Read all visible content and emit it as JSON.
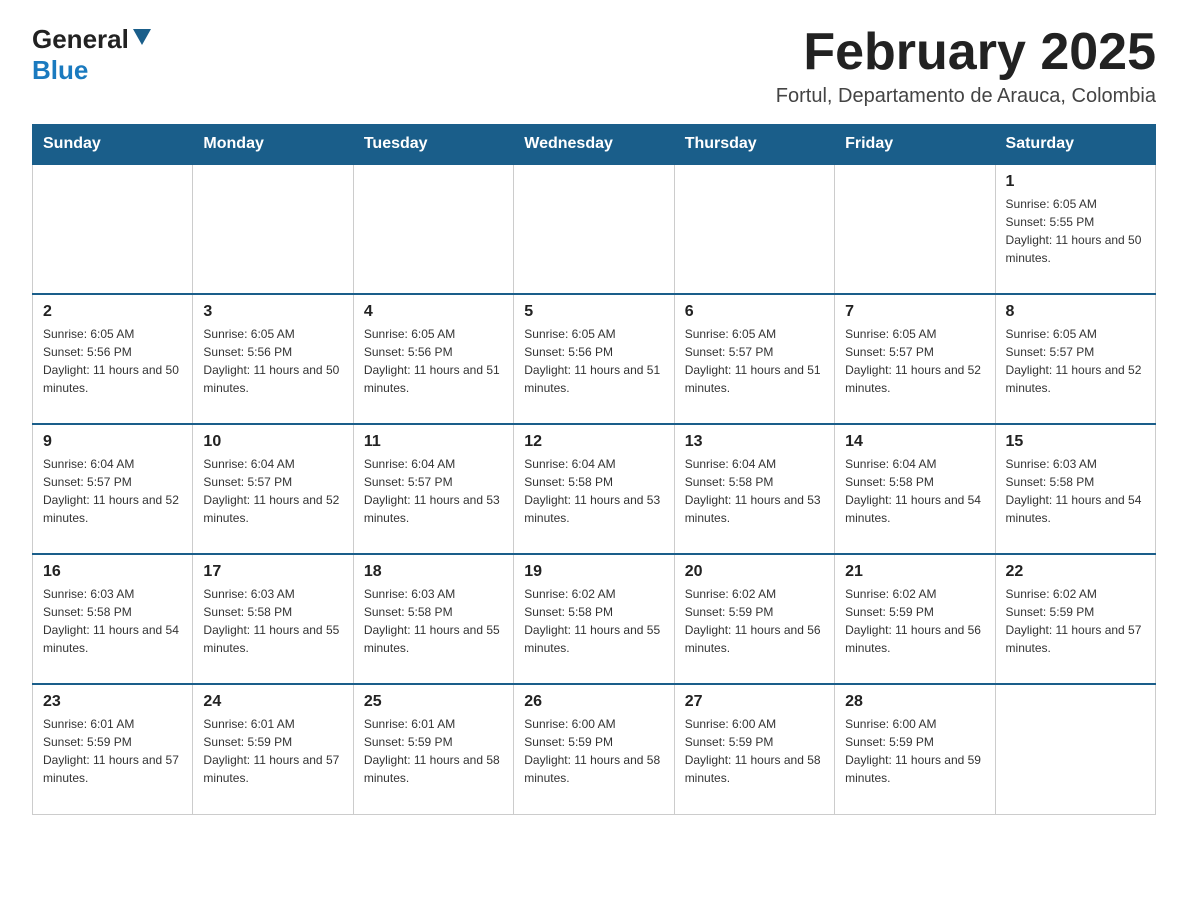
{
  "header": {
    "logo_general": "General",
    "logo_blue": "Blue",
    "month_title": "February 2025",
    "location": "Fortul, Departamento de Arauca, Colombia"
  },
  "days_of_week": [
    "Sunday",
    "Monday",
    "Tuesday",
    "Wednesday",
    "Thursday",
    "Friday",
    "Saturday"
  ],
  "weeks": [
    [
      {
        "day": "",
        "sunrise": "",
        "sunset": "",
        "daylight": ""
      },
      {
        "day": "",
        "sunrise": "",
        "sunset": "",
        "daylight": ""
      },
      {
        "day": "",
        "sunrise": "",
        "sunset": "",
        "daylight": ""
      },
      {
        "day": "",
        "sunrise": "",
        "sunset": "",
        "daylight": ""
      },
      {
        "day": "",
        "sunrise": "",
        "sunset": "",
        "daylight": ""
      },
      {
        "day": "",
        "sunrise": "",
        "sunset": "",
        "daylight": ""
      },
      {
        "day": "1",
        "sunrise": "Sunrise: 6:05 AM",
        "sunset": "Sunset: 5:55 PM",
        "daylight": "Daylight: 11 hours and 50 minutes."
      }
    ],
    [
      {
        "day": "2",
        "sunrise": "Sunrise: 6:05 AM",
        "sunset": "Sunset: 5:56 PM",
        "daylight": "Daylight: 11 hours and 50 minutes."
      },
      {
        "day": "3",
        "sunrise": "Sunrise: 6:05 AM",
        "sunset": "Sunset: 5:56 PM",
        "daylight": "Daylight: 11 hours and 50 minutes."
      },
      {
        "day": "4",
        "sunrise": "Sunrise: 6:05 AM",
        "sunset": "Sunset: 5:56 PM",
        "daylight": "Daylight: 11 hours and 51 minutes."
      },
      {
        "day": "5",
        "sunrise": "Sunrise: 6:05 AM",
        "sunset": "Sunset: 5:56 PM",
        "daylight": "Daylight: 11 hours and 51 minutes."
      },
      {
        "day": "6",
        "sunrise": "Sunrise: 6:05 AM",
        "sunset": "Sunset: 5:57 PM",
        "daylight": "Daylight: 11 hours and 51 minutes."
      },
      {
        "day": "7",
        "sunrise": "Sunrise: 6:05 AM",
        "sunset": "Sunset: 5:57 PM",
        "daylight": "Daylight: 11 hours and 52 minutes."
      },
      {
        "day": "8",
        "sunrise": "Sunrise: 6:05 AM",
        "sunset": "Sunset: 5:57 PM",
        "daylight": "Daylight: 11 hours and 52 minutes."
      }
    ],
    [
      {
        "day": "9",
        "sunrise": "Sunrise: 6:04 AM",
        "sunset": "Sunset: 5:57 PM",
        "daylight": "Daylight: 11 hours and 52 minutes."
      },
      {
        "day": "10",
        "sunrise": "Sunrise: 6:04 AM",
        "sunset": "Sunset: 5:57 PM",
        "daylight": "Daylight: 11 hours and 52 minutes."
      },
      {
        "day": "11",
        "sunrise": "Sunrise: 6:04 AM",
        "sunset": "Sunset: 5:57 PM",
        "daylight": "Daylight: 11 hours and 53 minutes."
      },
      {
        "day": "12",
        "sunrise": "Sunrise: 6:04 AM",
        "sunset": "Sunset: 5:58 PM",
        "daylight": "Daylight: 11 hours and 53 minutes."
      },
      {
        "day": "13",
        "sunrise": "Sunrise: 6:04 AM",
        "sunset": "Sunset: 5:58 PM",
        "daylight": "Daylight: 11 hours and 53 minutes."
      },
      {
        "day": "14",
        "sunrise": "Sunrise: 6:04 AM",
        "sunset": "Sunset: 5:58 PM",
        "daylight": "Daylight: 11 hours and 54 minutes."
      },
      {
        "day": "15",
        "sunrise": "Sunrise: 6:03 AM",
        "sunset": "Sunset: 5:58 PM",
        "daylight": "Daylight: 11 hours and 54 minutes."
      }
    ],
    [
      {
        "day": "16",
        "sunrise": "Sunrise: 6:03 AM",
        "sunset": "Sunset: 5:58 PM",
        "daylight": "Daylight: 11 hours and 54 minutes."
      },
      {
        "day": "17",
        "sunrise": "Sunrise: 6:03 AM",
        "sunset": "Sunset: 5:58 PM",
        "daylight": "Daylight: 11 hours and 55 minutes."
      },
      {
        "day": "18",
        "sunrise": "Sunrise: 6:03 AM",
        "sunset": "Sunset: 5:58 PM",
        "daylight": "Daylight: 11 hours and 55 minutes."
      },
      {
        "day": "19",
        "sunrise": "Sunrise: 6:02 AM",
        "sunset": "Sunset: 5:58 PM",
        "daylight": "Daylight: 11 hours and 55 minutes."
      },
      {
        "day": "20",
        "sunrise": "Sunrise: 6:02 AM",
        "sunset": "Sunset: 5:59 PM",
        "daylight": "Daylight: 11 hours and 56 minutes."
      },
      {
        "day": "21",
        "sunrise": "Sunrise: 6:02 AM",
        "sunset": "Sunset: 5:59 PM",
        "daylight": "Daylight: 11 hours and 56 minutes."
      },
      {
        "day": "22",
        "sunrise": "Sunrise: 6:02 AM",
        "sunset": "Sunset: 5:59 PM",
        "daylight": "Daylight: 11 hours and 57 minutes."
      }
    ],
    [
      {
        "day": "23",
        "sunrise": "Sunrise: 6:01 AM",
        "sunset": "Sunset: 5:59 PM",
        "daylight": "Daylight: 11 hours and 57 minutes."
      },
      {
        "day": "24",
        "sunrise": "Sunrise: 6:01 AM",
        "sunset": "Sunset: 5:59 PM",
        "daylight": "Daylight: 11 hours and 57 minutes."
      },
      {
        "day": "25",
        "sunrise": "Sunrise: 6:01 AM",
        "sunset": "Sunset: 5:59 PM",
        "daylight": "Daylight: 11 hours and 58 minutes."
      },
      {
        "day": "26",
        "sunrise": "Sunrise: 6:00 AM",
        "sunset": "Sunset: 5:59 PM",
        "daylight": "Daylight: 11 hours and 58 minutes."
      },
      {
        "day": "27",
        "sunrise": "Sunrise: 6:00 AM",
        "sunset": "Sunset: 5:59 PM",
        "daylight": "Daylight: 11 hours and 58 minutes."
      },
      {
        "day": "28",
        "sunrise": "Sunrise: 6:00 AM",
        "sunset": "Sunset: 5:59 PM",
        "daylight": "Daylight: 11 hours and 59 minutes."
      },
      {
        "day": "",
        "sunrise": "",
        "sunset": "",
        "daylight": ""
      }
    ]
  ]
}
